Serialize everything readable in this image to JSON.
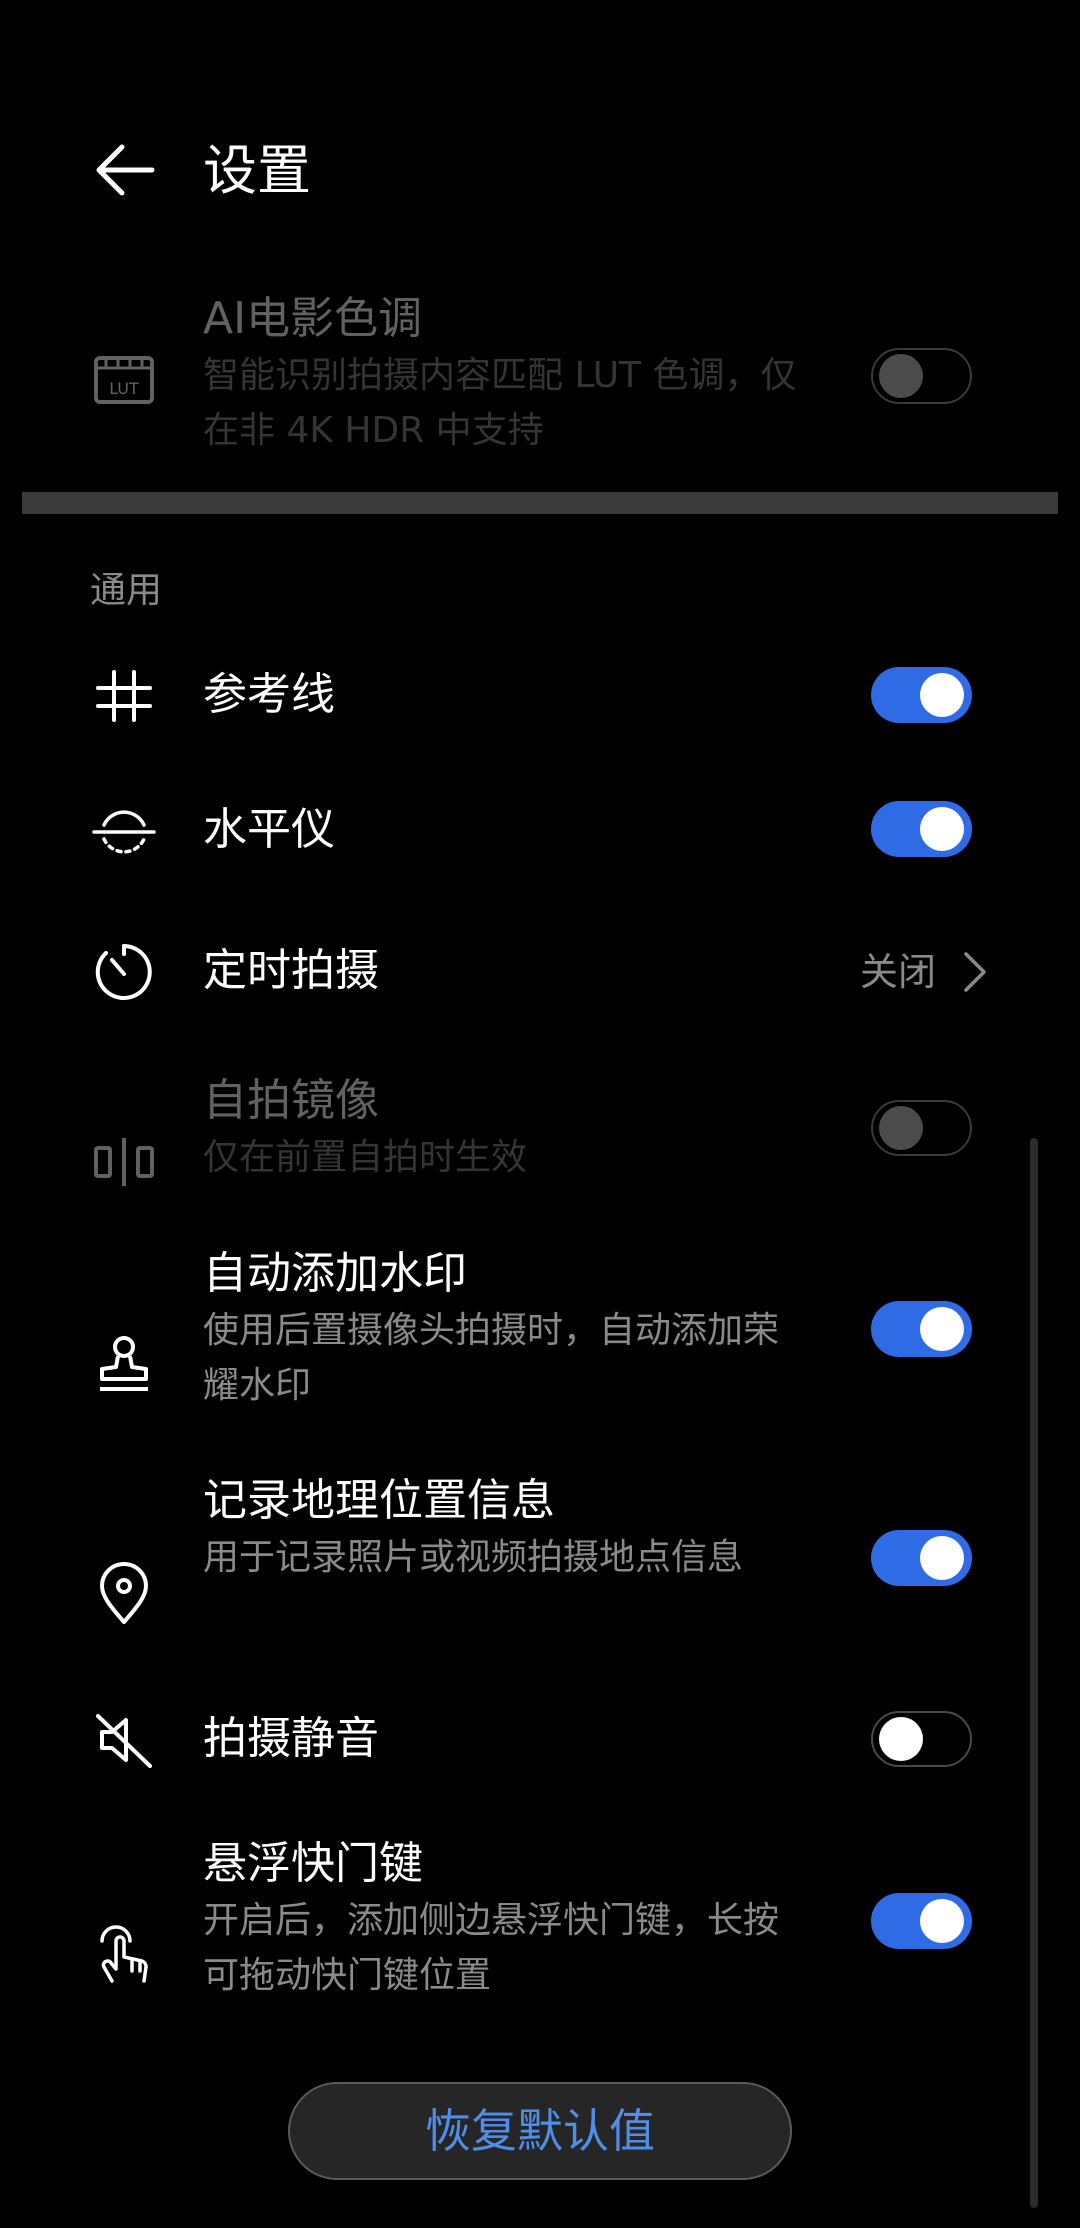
{
  "header": {
    "title": "设置"
  },
  "items": [
    {
      "id": "ai_movie",
      "label": "AI电影色调",
      "sub": "智能识别拍摄内容匹配 LUT 色调，仅在非 4K HDR 中支持",
      "icon": "lut-icon",
      "toggle": false,
      "disabled": true
    },
    {
      "id": "grid",
      "label": "参考线",
      "icon": "grid-icon",
      "toggle": true
    },
    {
      "id": "level",
      "label": "水平仪",
      "icon": "level-icon",
      "toggle": true
    },
    {
      "id": "timer",
      "label": "定时拍摄",
      "icon": "timer-icon",
      "value": "关闭"
    },
    {
      "id": "mirror",
      "label": "自拍镜像",
      "sub": "仅在前置自拍时生效",
      "icon": "mirror-icon",
      "toggle": false,
      "disabled": true
    },
    {
      "id": "watermark",
      "label": "自动添加水印",
      "sub": "使用后置摄像头拍摄时，自动添加荣耀水印",
      "icon": "stamp-icon",
      "toggle": true
    },
    {
      "id": "location",
      "label": "记录地理位置信息",
      "sub": "用于记录照片或视频拍摄地点信息",
      "icon": "location-pin-icon",
      "toggle": true
    },
    {
      "id": "mute",
      "label": "拍摄静音",
      "icon": "mute-icon",
      "toggle": false
    },
    {
      "id": "float_shutter",
      "label": "悬浮快门键",
      "sub": "开启后，添加侧边悬浮快门键，长按可拖动快门键位置",
      "icon": "touch-icon",
      "toggle": true
    }
  ],
  "section": {
    "general": "通用"
  },
  "footer": {
    "restore_label": "恢复默认值"
  },
  "colors": {
    "accent": "#2f6be4",
    "background": "#000000",
    "secondary_text": "#8a8a8a"
  }
}
